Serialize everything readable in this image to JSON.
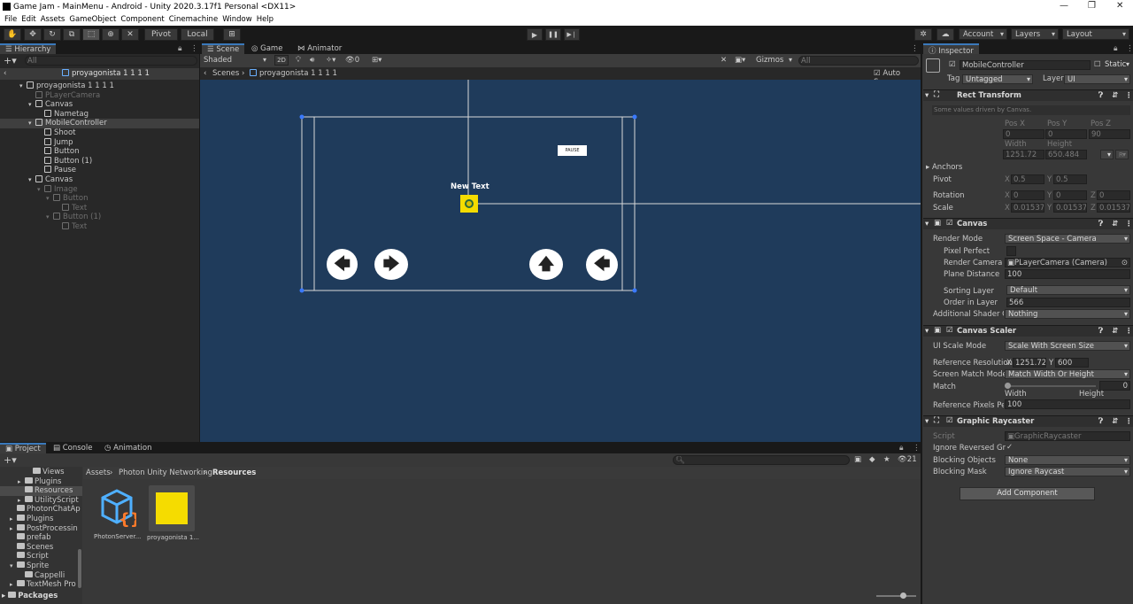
{
  "window": {
    "title": "Game Jam - MainMenu - Android - Unity 2020.3.17f1 Personal <DX11>",
    "min": "—",
    "max": "❐",
    "close": "✕"
  },
  "menu": [
    "File",
    "Edit",
    "Assets",
    "GameObject",
    "Component",
    "Cinemachine",
    "Window",
    "Help"
  ],
  "toolbar": {
    "pivot": "Pivot",
    "local": "Local",
    "account": "Account",
    "layers": "Layers",
    "layout": "Layout",
    "play": "▶",
    "pause": "❚❚",
    "step": "▶❘"
  },
  "hierarchy": {
    "tab": "Hierarchy",
    "search_placeholder": "All",
    "scene": "proyagonista 1 1 1 1",
    "items": [
      {
        "label": "proyagonista 1 1 1 1",
        "indent": 0,
        "arrow": "▾",
        "dim": false,
        "sel": false
      },
      {
        "label": "PLayerCamera",
        "indent": 1,
        "arrow": "",
        "dim": true,
        "sel": false
      },
      {
        "label": "Canvas",
        "indent": 1,
        "arrow": "▾",
        "dim": false,
        "sel": false
      },
      {
        "label": "Nametag",
        "indent": 2,
        "arrow": "",
        "dim": false,
        "sel": false
      },
      {
        "label": "MobileController",
        "indent": 1,
        "arrow": "▾",
        "dim": false,
        "sel": true
      },
      {
        "label": "Shoot",
        "indent": 2,
        "arrow": "",
        "dim": false,
        "sel": false
      },
      {
        "label": "Jump",
        "indent": 2,
        "arrow": "",
        "dim": false,
        "sel": false
      },
      {
        "label": "Button",
        "indent": 2,
        "arrow": "",
        "dim": false,
        "sel": false
      },
      {
        "label": "Button (1)",
        "indent": 2,
        "arrow": "",
        "dim": false,
        "sel": false
      },
      {
        "label": "Pause",
        "indent": 2,
        "arrow": "",
        "dim": false,
        "sel": false
      },
      {
        "label": "Canvas",
        "indent": 1,
        "arrow": "▾",
        "dim": false,
        "sel": false
      },
      {
        "label": "Image",
        "indent": 2,
        "arrow": "▾",
        "dim": true,
        "sel": false
      },
      {
        "label": "Button",
        "indent": 3,
        "arrow": "▾",
        "dim": true,
        "sel": false
      },
      {
        "label": "Text",
        "indent": 4,
        "arrow": "",
        "dim": true,
        "sel": false
      },
      {
        "label": "Button (1)",
        "indent": 3,
        "arrow": "▾",
        "dim": true,
        "sel": false
      },
      {
        "label": "Text",
        "indent": 4,
        "arrow": "",
        "dim": true,
        "sel": false
      }
    ]
  },
  "scene": {
    "tabs": [
      "Scene",
      "Game",
      "Animator"
    ],
    "shaded": "Shaded",
    "mode2d": "2D",
    "gizmos": "Gizmos",
    "search_placeholder": "All",
    "scenes_crumb": "Scenes",
    "scene_crumb": "proyagonista 1 1 1 1",
    "auto_save": "Auto Save",
    "new_text": "New Text",
    "pause_label": "PAUSE",
    "hidden_count": "0"
  },
  "project": {
    "tabs": [
      "Project",
      "Console",
      "Animation"
    ],
    "breadcrumb": [
      "Assets",
      "Photon Unity Networking",
      "Resources"
    ],
    "hidden_count": "21",
    "tree": [
      {
        "label": "Views",
        "indent": 3,
        "arrow": "",
        "sel": false
      },
      {
        "label": "Plugins",
        "indent": 2,
        "arrow": "▸",
        "sel": false
      },
      {
        "label": "Resources",
        "indent": 2,
        "arrow": "",
        "sel": true
      },
      {
        "label": "UtilityScript",
        "indent": 2,
        "arrow": "▸",
        "sel": false
      },
      {
        "label": "PhotonChatAp",
        "indent": 1,
        "arrow": "",
        "sel": false
      },
      {
        "label": "Plugins",
        "indent": 1,
        "arrow": "▸",
        "sel": false
      },
      {
        "label": "PostProcessin",
        "indent": 1,
        "arrow": "▸",
        "sel": false
      },
      {
        "label": "prefab",
        "indent": 1,
        "arrow": "",
        "sel": false
      },
      {
        "label": "Scenes",
        "indent": 1,
        "arrow": "",
        "sel": false
      },
      {
        "label": "Script",
        "indent": 1,
        "arrow": "",
        "sel": false
      },
      {
        "label": "Sprite",
        "indent": 1,
        "arrow": "▾",
        "sel": false
      },
      {
        "label": "Cappelli",
        "indent": 2,
        "arrow": "",
        "sel": false
      },
      {
        "label": "TextMesh Pro",
        "indent": 1,
        "arrow": "▸",
        "sel": false
      }
    ],
    "packages": "Packages",
    "assets": [
      {
        "label": "PhotonServer..."
      },
      {
        "label": "proyagonista 1..."
      }
    ]
  },
  "inspector": {
    "tab": "Inspector",
    "object_name": "MobileController",
    "static": "Static",
    "tag_label": "Tag",
    "tag": "Untagged",
    "layer_label": "Layer",
    "layer": "UI",
    "rect": {
      "title": "Rect Transform",
      "note": "Some values driven by Canvas.",
      "posx_l": "Pos X",
      "posy_l": "Pos Y",
      "posz_l": "Pos Z",
      "posx": "0",
      "posy": "0",
      "posz": "90",
      "width_l": "Width",
      "height_l": "Height",
      "width": "1251.72",
      "height": "650.484",
      "anchors": "Anchors",
      "pivot": "Pivot",
      "pivot_x": "0.5",
      "pivot_y": "0.5",
      "rotation": "Rotation",
      "rot_x": "0",
      "rot_y": "0",
      "rot_z": "0",
      "scale": "Scale",
      "sc_x": "0.01537:",
      "sc_y": "0.01537:",
      "sc_z": "0.01537:",
      "r": "R",
      "x": "X",
      "y": "Y",
      "z": "Z"
    },
    "canvas": {
      "title": "Canvas",
      "render_mode_l": "Render Mode",
      "render_mode": "Screen Space - Camera",
      "pixel_perfect_l": "Pixel Perfect",
      "render_camera_l": "Render Camera",
      "render_camera": "PLayerCamera (Camera)",
      "plane_distance_l": "Plane Distance",
      "plane_distance": "100",
      "sorting_layer_l": "Sorting Layer",
      "sorting_layer": "Default",
      "order_l": "Order in Layer",
      "order": "566",
      "shader_l": "Additional Shader Cha",
      "shader": "Nothing"
    },
    "scaler": {
      "title": "Canvas Scaler",
      "ui_scale_l": "UI Scale Mode",
      "ui_scale": "Scale With Screen Size",
      "ref_res_l": "Reference Resolution",
      "ref_x": "1251.72",
      "ref_y": "600",
      "match_mode_l": "Screen Match Mode",
      "match_mode": "Match Width Or Height",
      "match_l": "Match",
      "match_val": "0",
      "match_level": 0,
      "width": "Width",
      "height": "Height",
      "ppu_l": "Reference Pixels Per U",
      "ppu": "100"
    },
    "raycaster": {
      "title": "Graphic Raycaster",
      "script_l": "Script",
      "script": "GraphicRaycaster",
      "ignore_l": "Ignore Reversed Grap",
      "blocking_l": "Blocking Objects",
      "blocking": "None",
      "mask_l": "Blocking Mask",
      "mask": "Ignore Raycast"
    },
    "add_component": "Add Component"
  },
  "colors": {
    "scene_bg": "#1e3a5a",
    "accent": "#3a79bb",
    "yellow": "#f5dc00"
  }
}
